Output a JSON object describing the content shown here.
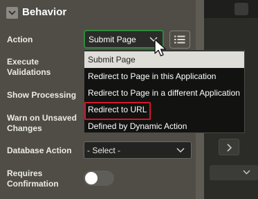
{
  "section": {
    "title": "Behavior",
    "toggle_icon": "chevron-down-icon"
  },
  "labels": {
    "action": "Action",
    "execute_validations_1": "Execute",
    "execute_validations_2": "Validations",
    "show_processing": "Show Processing",
    "warn_unsaved_1": "Warn on Unsaved",
    "warn_unsaved_2": "Changes",
    "database_action": "Database Action",
    "requires_confirmation_1": "Requires",
    "requires_confirmation_2": "Confirmation"
  },
  "action_select": {
    "value": "Submit Page",
    "icon": "chevron-down-icon"
  },
  "action_dropdown": {
    "options": [
      "Submit Page",
      "Redirect to Page in this Application",
      "Redirect to Page in a different Application",
      "Redirect to URL",
      "Defined by Dynamic Action"
    ],
    "selected": "Submit Page",
    "highlighted": "Redirect to URL"
  },
  "database_action_select": {
    "value": "- Select -",
    "icon": "chevron-down-icon"
  },
  "requires_confirmation_toggle": {
    "on": false
  },
  "colors": {
    "panel_bg": "#4f4d46",
    "focus_border": "#2f8a3c",
    "dropdown_bg": "#121211",
    "selected_option_bg": "#deddd8",
    "highlight_border": "#d3182a"
  }
}
